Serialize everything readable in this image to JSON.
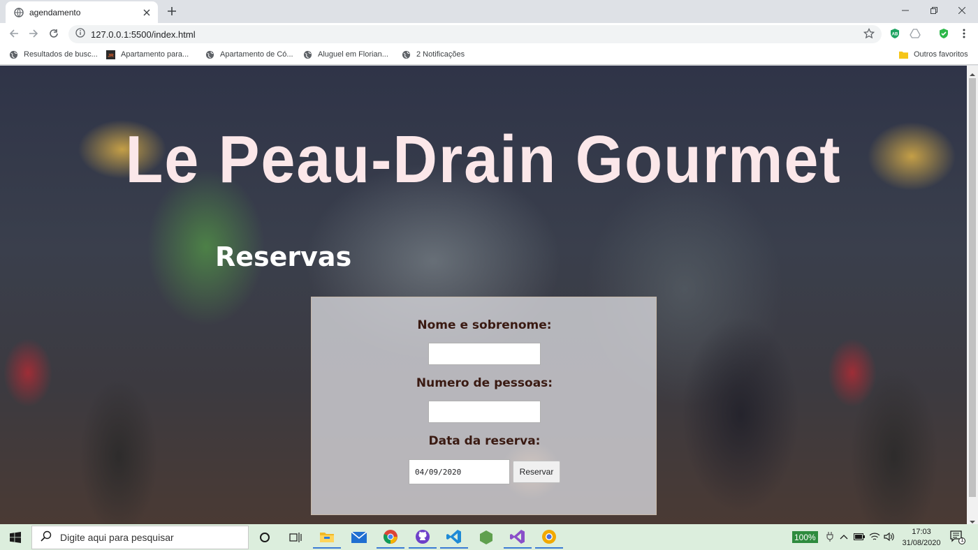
{
  "browser": {
    "tab_title": "agendamento",
    "url": "127.0.0.1:5500/index.html",
    "bookmarks": [
      {
        "label": "Resultados de busc...",
        "icon": "globe-icon"
      },
      {
        "label": "Apartamento para...",
        "icon": "jr-logo-icon"
      },
      {
        "label": "Apartamento de Có...",
        "icon": "globe-icon"
      },
      {
        "label": "Aluguel em Florian...",
        "icon": "globe-icon"
      },
      {
        "label": "2 Notificações",
        "icon": "globe-icon"
      }
    ],
    "other_bookmarks": "Outros favoritos",
    "extensions": [
      {
        "name": "adblock-icon",
        "text": "AB",
        "color": "#1ea362"
      },
      {
        "name": "drive-icon",
        "color": "#9aa0a6"
      },
      {
        "name": "shield-check-icon",
        "color": "#2db84a"
      }
    ]
  },
  "page": {
    "site_title": "Le Peau-Drain Gourmet",
    "section_title": "Reservas",
    "form": {
      "name_label": "Nome e sobrenome:",
      "name_value": "",
      "people_label": "Numero de pessoas:",
      "people_value": "",
      "date_label": "Data da reserva:",
      "date_value": "04/09/2020",
      "submit_label": "Reservar"
    }
  },
  "taskbar": {
    "search_placeholder": "Digite aqui para pesquisar",
    "apps": [
      "cortana-icon",
      "task-view-icon",
      "file-explorer-icon",
      "mail-icon",
      "chrome-icon",
      "github-icon",
      "vscode-icon",
      "nodejs-icon",
      "visual-studio-icon",
      "chrome-canary-icon"
    ],
    "battery": "100%",
    "time": "17:03",
    "date": "31/08/2020",
    "notifications": "1"
  },
  "colors": {
    "title_color": "#fbe7e9",
    "label_color": "#3a1a12",
    "taskbar_bg": "#dceedd"
  }
}
